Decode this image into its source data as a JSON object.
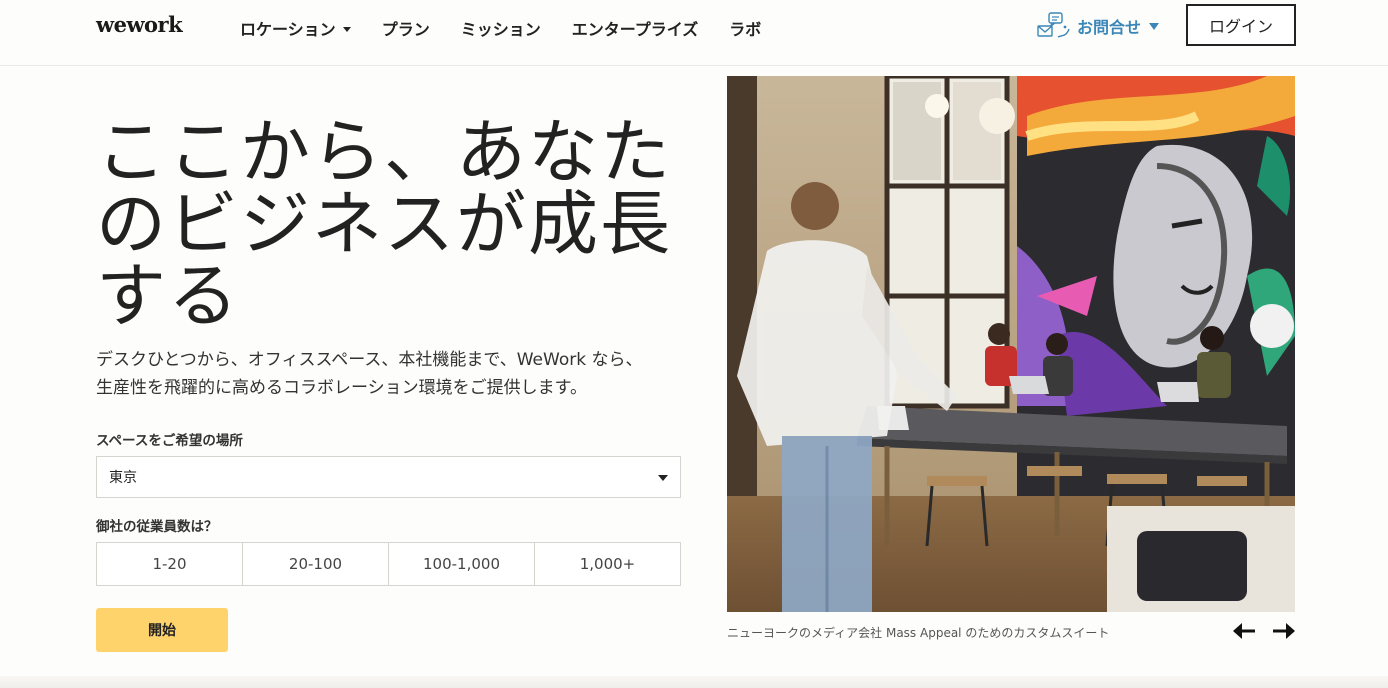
{
  "header": {
    "logo": "wework",
    "nav": [
      {
        "label": "ロケーション",
        "has_dropdown": true
      },
      {
        "label": "プラン"
      },
      {
        "label": "ミッション"
      },
      {
        "label": "エンタープライズ"
      },
      {
        "label": "ラボ"
      }
    ],
    "contact_label": "お問合せ",
    "login_label": "ログイン"
  },
  "hero": {
    "headline": "ここから、あなたのビジネスが成長する",
    "subtext_line1": "デスクひとつから、オフィススペース、本社機能まで、WeWork なら、",
    "subtext_line2": "生産性を飛躍的に高めるコラボレーション環境をご提供します。",
    "location_label": "スペースをご希望の場所",
    "location_value": "東京",
    "employees_label": "御社の従業員数は？",
    "employee_options": [
      "1-20",
      "20-100",
      "100-1,000",
      "1,000+"
    ],
    "start_label": "開始"
  },
  "carousel": {
    "caption": "ニューヨークのメディア会社 Mass Appeal のためのカスタムスイート"
  },
  "colors": {
    "accent_yellow": "#ffd36b",
    "contact_blue": "#3a86b8",
    "background": "#fdfdfb"
  }
}
